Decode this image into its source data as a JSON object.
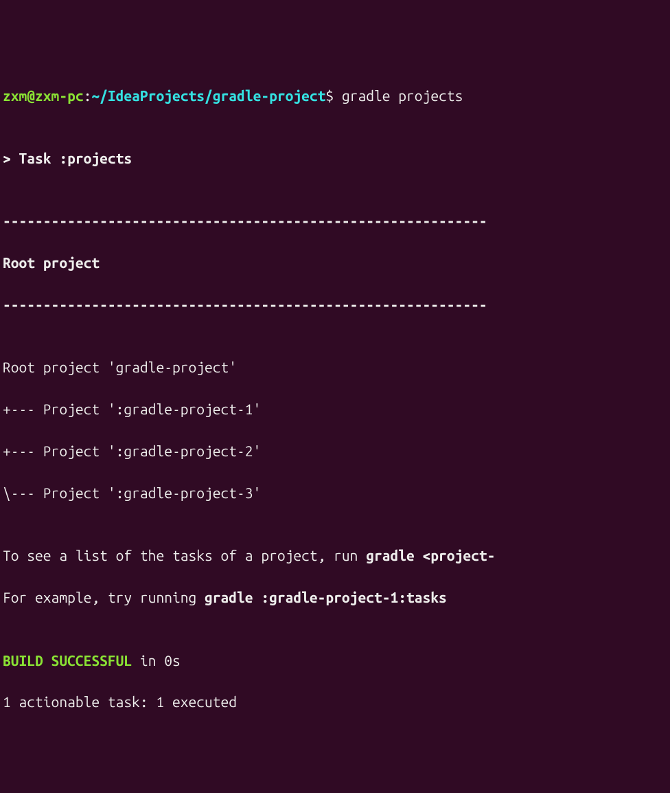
{
  "prompt": {
    "user_host": "zxm@zxm-pc",
    "sep1": ":",
    "path": "~/IdeaProjects/gradle-project",
    "sep2": "$ ",
    "command": "gradle projects"
  },
  "blank": "",
  "task_header": "> Task :projects",
  "divider": "------------------------------------------------------------\n------------------------------------------------------------\n------------------------------------------------------------",
  "dashes_line": "------------------------------------------------------------",
  "root_header": "Root project",
  "tree": {
    "root": "Root project 'gradle-project'",
    "p1": "+--- Project ':gradle-project-1'",
    "p2": "+--- Project ':gradle-project-2'",
    "p3": "\\--- Project ':gradle-project-3'"
  },
  "hint1_pre": "To see a list of the tasks of a project, run ",
  "hint1_bold": "gradle <project-",
  "hint2_pre": "For example, try running ",
  "hint2_bold": "gradle :gradle-project-1:tasks",
  "build_status": "BUILD SUCCESSFUL",
  "build_time": " in 0s",
  "summary": "1 actionable task: 1 executed"
}
